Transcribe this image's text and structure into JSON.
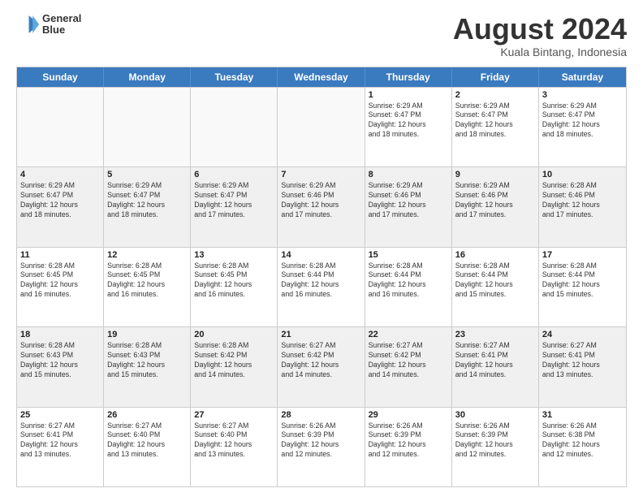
{
  "header": {
    "logo_line1": "General",
    "logo_line2": "Blue",
    "month_year": "August 2024",
    "location": "Kuala Bintang, Indonesia"
  },
  "weekdays": [
    "Sunday",
    "Monday",
    "Tuesday",
    "Wednesday",
    "Thursday",
    "Friday",
    "Saturday"
  ],
  "weeks": [
    [
      {
        "day": "",
        "info": ""
      },
      {
        "day": "",
        "info": ""
      },
      {
        "day": "",
        "info": ""
      },
      {
        "day": "",
        "info": ""
      },
      {
        "day": "1",
        "info": "Sunrise: 6:29 AM\nSunset: 6:47 PM\nDaylight: 12 hours\nand 18 minutes."
      },
      {
        "day": "2",
        "info": "Sunrise: 6:29 AM\nSunset: 6:47 PM\nDaylight: 12 hours\nand 18 minutes."
      },
      {
        "day": "3",
        "info": "Sunrise: 6:29 AM\nSunset: 6:47 PM\nDaylight: 12 hours\nand 18 minutes."
      }
    ],
    [
      {
        "day": "4",
        "info": "Sunrise: 6:29 AM\nSunset: 6:47 PM\nDaylight: 12 hours\nand 18 minutes."
      },
      {
        "day": "5",
        "info": "Sunrise: 6:29 AM\nSunset: 6:47 PM\nDaylight: 12 hours\nand 18 minutes."
      },
      {
        "day": "6",
        "info": "Sunrise: 6:29 AM\nSunset: 6:47 PM\nDaylight: 12 hours\nand 17 minutes."
      },
      {
        "day": "7",
        "info": "Sunrise: 6:29 AM\nSunset: 6:46 PM\nDaylight: 12 hours\nand 17 minutes."
      },
      {
        "day": "8",
        "info": "Sunrise: 6:29 AM\nSunset: 6:46 PM\nDaylight: 12 hours\nand 17 minutes."
      },
      {
        "day": "9",
        "info": "Sunrise: 6:29 AM\nSunset: 6:46 PM\nDaylight: 12 hours\nand 17 minutes."
      },
      {
        "day": "10",
        "info": "Sunrise: 6:28 AM\nSunset: 6:46 PM\nDaylight: 12 hours\nand 17 minutes."
      }
    ],
    [
      {
        "day": "11",
        "info": "Sunrise: 6:28 AM\nSunset: 6:45 PM\nDaylight: 12 hours\nand 16 minutes."
      },
      {
        "day": "12",
        "info": "Sunrise: 6:28 AM\nSunset: 6:45 PM\nDaylight: 12 hours\nand 16 minutes."
      },
      {
        "day": "13",
        "info": "Sunrise: 6:28 AM\nSunset: 6:45 PM\nDaylight: 12 hours\nand 16 minutes."
      },
      {
        "day": "14",
        "info": "Sunrise: 6:28 AM\nSunset: 6:44 PM\nDaylight: 12 hours\nand 16 minutes."
      },
      {
        "day": "15",
        "info": "Sunrise: 6:28 AM\nSunset: 6:44 PM\nDaylight: 12 hours\nand 16 minutes."
      },
      {
        "day": "16",
        "info": "Sunrise: 6:28 AM\nSunset: 6:44 PM\nDaylight: 12 hours\nand 15 minutes."
      },
      {
        "day": "17",
        "info": "Sunrise: 6:28 AM\nSunset: 6:44 PM\nDaylight: 12 hours\nand 15 minutes."
      }
    ],
    [
      {
        "day": "18",
        "info": "Sunrise: 6:28 AM\nSunset: 6:43 PM\nDaylight: 12 hours\nand 15 minutes."
      },
      {
        "day": "19",
        "info": "Sunrise: 6:28 AM\nSunset: 6:43 PM\nDaylight: 12 hours\nand 15 minutes."
      },
      {
        "day": "20",
        "info": "Sunrise: 6:28 AM\nSunset: 6:42 PM\nDaylight: 12 hours\nand 14 minutes."
      },
      {
        "day": "21",
        "info": "Sunrise: 6:27 AM\nSunset: 6:42 PM\nDaylight: 12 hours\nand 14 minutes."
      },
      {
        "day": "22",
        "info": "Sunrise: 6:27 AM\nSunset: 6:42 PM\nDaylight: 12 hours\nand 14 minutes."
      },
      {
        "day": "23",
        "info": "Sunrise: 6:27 AM\nSunset: 6:41 PM\nDaylight: 12 hours\nand 14 minutes."
      },
      {
        "day": "24",
        "info": "Sunrise: 6:27 AM\nSunset: 6:41 PM\nDaylight: 12 hours\nand 13 minutes."
      }
    ],
    [
      {
        "day": "25",
        "info": "Sunrise: 6:27 AM\nSunset: 6:41 PM\nDaylight: 12 hours\nand 13 minutes."
      },
      {
        "day": "26",
        "info": "Sunrise: 6:27 AM\nSunset: 6:40 PM\nDaylight: 12 hours\nand 13 minutes."
      },
      {
        "day": "27",
        "info": "Sunrise: 6:27 AM\nSunset: 6:40 PM\nDaylight: 12 hours\nand 13 minutes."
      },
      {
        "day": "28",
        "info": "Sunrise: 6:26 AM\nSunset: 6:39 PM\nDaylight: 12 hours\nand 12 minutes."
      },
      {
        "day": "29",
        "info": "Sunrise: 6:26 AM\nSunset: 6:39 PM\nDaylight: 12 hours\nand 12 minutes."
      },
      {
        "day": "30",
        "info": "Sunrise: 6:26 AM\nSunset: 6:39 PM\nDaylight: 12 hours\nand 12 minutes."
      },
      {
        "day": "31",
        "info": "Sunrise: 6:26 AM\nSunset: 6:38 PM\nDaylight: 12 hours\nand 12 minutes."
      }
    ]
  ]
}
